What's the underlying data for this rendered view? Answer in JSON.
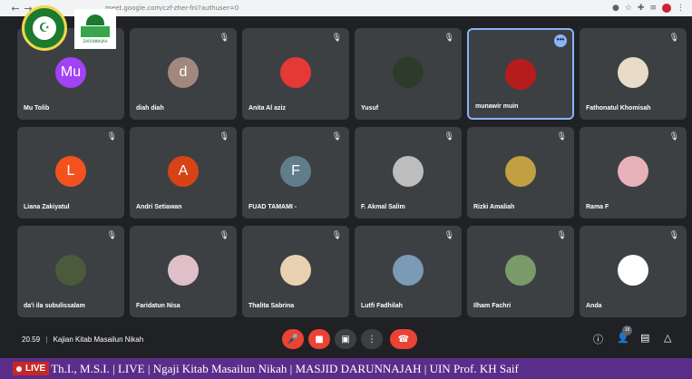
{
  "browser": {
    "url": "meet.google.com/czf-zher-fni?authuser=0"
  },
  "participants": [
    {
      "name": "Mu Tolib",
      "initials": "Mu",
      "color": "#a142f4",
      "muted": false
    },
    {
      "name": "diah diah",
      "initials": "d",
      "color": "#a1887f",
      "muted": true
    },
    {
      "name": "Anita Al aziz",
      "initials": "",
      "color": "#e53935",
      "muted": true
    },
    {
      "name": "Yusuf",
      "initials": "",
      "color": "#2e3b2a",
      "muted": true
    },
    {
      "name": "munawir muin",
      "initials": "",
      "color": "#b71c1c",
      "muted": false,
      "active": true
    },
    {
      "name": "Fathonatul Khomisah",
      "initials": "",
      "color": "#e8dcc8",
      "muted": true
    },
    {
      "name": "Liana Zakiyatul",
      "initials": "L",
      "color": "#f4511e",
      "muted": true
    },
    {
      "name": "Andri Setiawan",
      "initials": "A",
      "color": "#d84315",
      "muted": true
    },
    {
      "name": "FUAD TAMAMI -",
      "initials": "F",
      "color": "#5f7d8a",
      "muted": true
    },
    {
      "name": "F. Akmal Salim",
      "initials": "",
      "color": "#bdbdbd",
      "muted": true
    },
    {
      "name": "Rizki Amaliah",
      "initials": "",
      "color": "#c0a040",
      "muted": true
    },
    {
      "name": "Rama F",
      "initials": "",
      "color": "#e8b0b8",
      "muted": true
    },
    {
      "name": "da'i ila subulissalam",
      "initials": "",
      "color": "#4a5a3a",
      "muted": true
    },
    {
      "name": "Faridatun Nisa",
      "initials": "",
      "color": "#e0c0c8",
      "muted": true
    },
    {
      "name": "Thalita Sabrina",
      "initials": "",
      "color": "#e8d0b0",
      "muted": true
    },
    {
      "name": "Lutfi Fadhilah",
      "initials": "",
      "color": "#7a9ab8",
      "muted": true
    },
    {
      "name": "Ilham Fachri",
      "initials": "",
      "color": "#7a9a6a",
      "muted": true
    },
    {
      "name": "Anda",
      "initials": "",
      "color": "#ffffff",
      "muted": true
    }
  ],
  "meeting": {
    "time": "20.59",
    "title": "Kajian Kitab Masailun Nikah",
    "participant_count": "18"
  },
  "ticker": {
    "live_label": "LIVE",
    "text": "Th.I., M.S.I. | LIVE | Ngaji Kitab Masailun Nikah | MASJID DARUNNAJAH | UIN Prof. KH Saif"
  }
}
